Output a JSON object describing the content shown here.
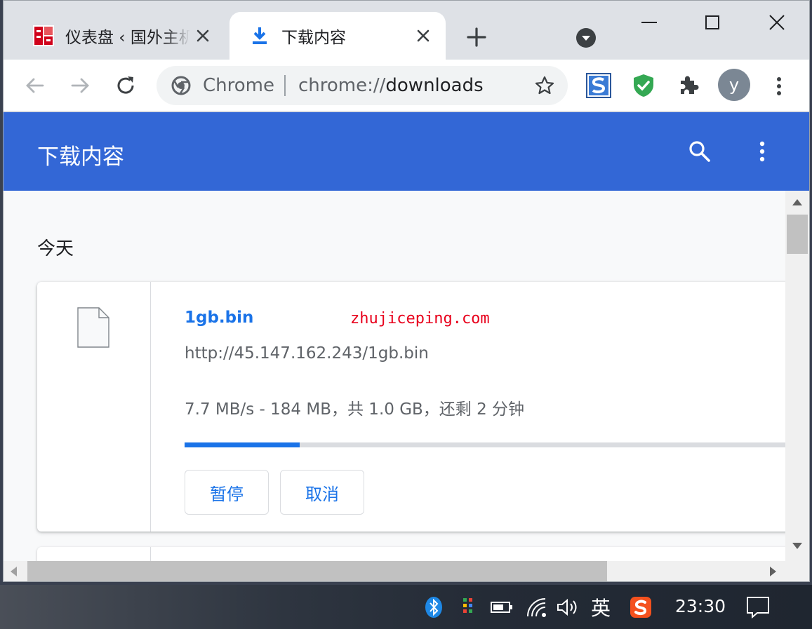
{
  "tabs": [
    {
      "title": "仪表盘 ‹ 国外主机",
      "active": false
    },
    {
      "title": "下载内容",
      "active": true
    }
  ],
  "omnibox": {
    "chip_label": "Chrome",
    "url_scheme": "chrome://",
    "url_host": "downloads"
  },
  "profile": {
    "avatar_letter": "y"
  },
  "downloads_page": {
    "title": "下载内容",
    "section_label": "今天",
    "items": [
      {
        "file_name": "1gb.bin",
        "watermark": "zhujiceping.com",
        "url": "http://45.147.162.243/1gb.bin",
        "status": "7.7 MB/s - 184 MB，共 1.0 GB，还剩 2 分钟",
        "progress_fraction": 0.184,
        "pause_label": "暂停",
        "cancel_label": "取消"
      }
    ]
  },
  "taskbar": {
    "ime_label": "英",
    "clock": "23:30"
  },
  "colors": {
    "header_blue": "#3367d6",
    "link_blue": "#1a73e8",
    "watermark_red": "#e8001c"
  }
}
